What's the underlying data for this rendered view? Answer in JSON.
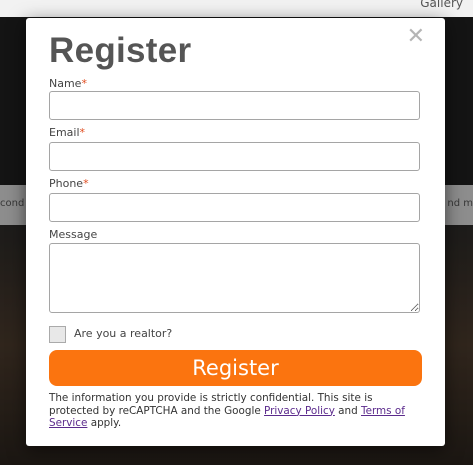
{
  "background": {
    "gallery_link": "Gallery",
    "side_left_text": "cond",
    "side_right_text": "nd m"
  },
  "modal": {
    "close_symbol": "✕",
    "title": "Register",
    "fields": {
      "name": {
        "label": "Name",
        "required_mark": "*",
        "value": ""
      },
      "email": {
        "label": "Email",
        "required_mark": "*",
        "value": ""
      },
      "phone": {
        "label": "Phone",
        "required_mark": "*",
        "value": ""
      },
      "message": {
        "label": "Message",
        "value": ""
      }
    },
    "realtor_checkbox": {
      "label": "Are you a realtor?",
      "checked": false
    },
    "submit_label": "Register",
    "disclaimer": {
      "text_1": "The information you provide is strictly confidential. This site is protected by reCAPTCHA and the Google ",
      "privacy_link": "Privacy Policy",
      "text_2": " and ",
      "terms_link": "Terms of Service",
      "text_3": " apply."
    }
  },
  "colors": {
    "accent": "#fb740f",
    "required": "#e04c1f",
    "link": "#5b2a8c"
  }
}
